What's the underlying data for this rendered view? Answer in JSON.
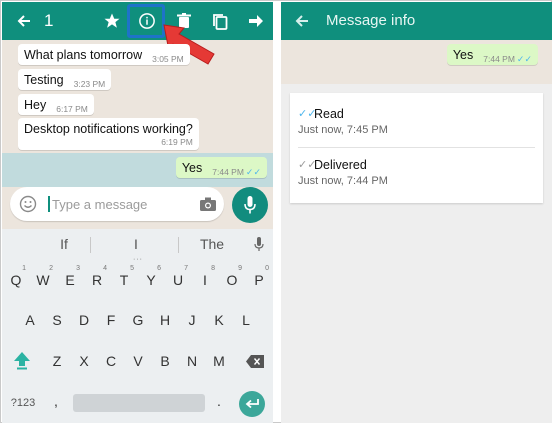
{
  "left": {
    "selection_count": "1",
    "messages": [
      {
        "text": "What plans tomorrow",
        "time": "3:05 PM"
      },
      {
        "text": "Testing",
        "time": "3:23 PM"
      },
      {
        "text": "Hey",
        "time": "6:17 PM"
      },
      {
        "text": "Desktop notifications working?",
        "time": "6:19 PM"
      }
    ],
    "outgoing": {
      "text": "Yes",
      "time": "7:44 PM"
    },
    "input_placeholder": "Type a message",
    "suggestions": [
      "If",
      "I",
      "The"
    ],
    "keyboard": {
      "row1": [
        "Q",
        "W",
        "E",
        "R",
        "T",
        "Y",
        "U",
        "I",
        "O",
        "P"
      ],
      "row1_numbers": [
        "1",
        "2",
        "3",
        "4",
        "5",
        "6",
        "7",
        "8",
        "9",
        "0"
      ],
      "row2": [
        "A",
        "S",
        "D",
        "F",
        "G",
        "H",
        "J",
        "K",
        "L"
      ],
      "row3": [
        "Z",
        "X",
        "C",
        "V",
        "B",
        "N",
        "M"
      ],
      "symbols_key": "?123",
      "comma_key": ","
    }
  },
  "right": {
    "title": "Message info",
    "message": {
      "text": "Yes",
      "time": "7:44 PM"
    },
    "read": {
      "label": "Read",
      "time": "Just now, 7:45 PM"
    },
    "delivered": {
      "label": "Delivered",
      "time": "Just now, 7:44 PM"
    }
  },
  "colors": {
    "toolbar": "#0f8f7d",
    "highlight": "#1e73c8",
    "arrow": "#e53935",
    "read_ticks": "#4fb6ec",
    "outgoing_bubble": "#dcf8c6"
  }
}
